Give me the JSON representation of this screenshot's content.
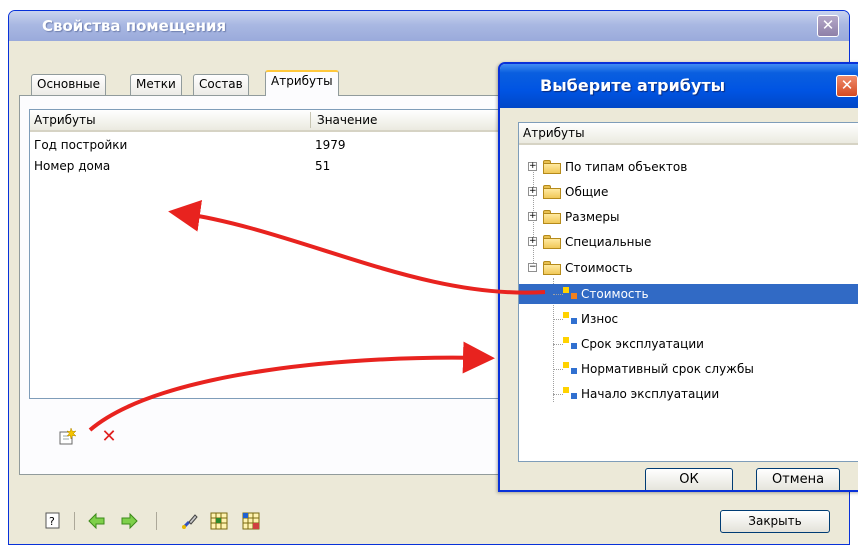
{
  "main_window": {
    "title": "Свойства помещения",
    "close_label": "✕",
    "tabs": [
      "Основные",
      "Метки",
      "Состав",
      "Атрибуты"
    ],
    "active_tab": "Атрибуты",
    "list": {
      "col_attr": "Атрибуты",
      "col_value": "Значение",
      "rows": [
        {
          "attr": "Год постройки",
          "value": "1979"
        },
        {
          "attr": "Номер дома",
          "value": "51"
        }
      ]
    },
    "close_button": "Закрыть"
  },
  "dialog": {
    "title": "Выберите атрибуты",
    "tree_header": "Атрибуты",
    "folders": [
      "По типам объектов",
      "Общие",
      "Размеры",
      "Специальные",
      "Стоимость"
    ],
    "children": [
      "Стоимость",
      "Износ",
      "Срок эксплуатации",
      "Нормативный срок службы",
      "Начало эксплуатации"
    ],
    "selected_child": "Стоимость",
    "ok": "ОК",
    "cancel": "Отмена"
  },
  "colors": {
    "selection": "#316ac5",
    "arrow": "#e8231f",
    "dialog_title": "#0054e3",
    "inactive_title": "#a9b8e2"
  }
}
